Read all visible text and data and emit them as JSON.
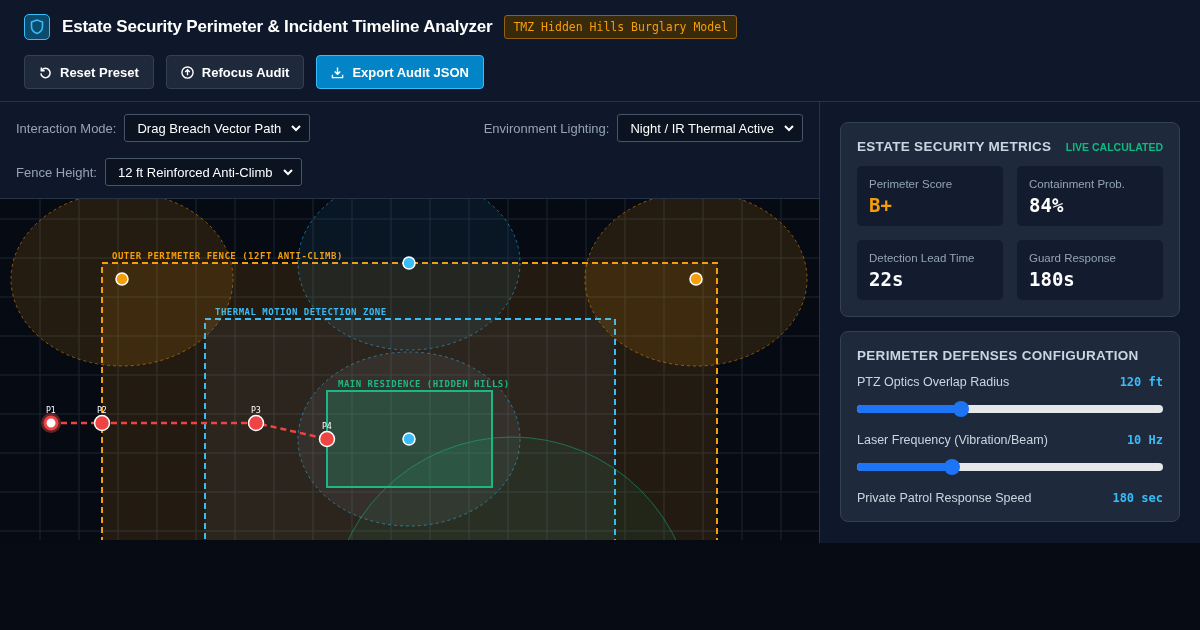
{
  "header": {
    "title": "Estate Security Perimeter & Incident Timeline Analyzer",
    "badge": "TMZ Hidden Hills Burglary Model"
  },
  "buttons": [
    {
      "label": "Reset Preset",
      "kind": "reset",
      "primary": false
    },
    {
      "label": "Refocus Audit",
      "kind": "refocus",
      "primary": false
    },
    {
      "label": "Export Audit JSON",
      "kind": "export",
      "primary": true
    }
  ],
  "controls": [
    {
      "label": "Interaction Mode:",
      "value": "Drag Breach Vector Path"
    },
    {
      "label": "Environment Lighting:",
      "value": "Night / IR Thermal Active"
    },
    {
      "label": "Fence Height:",
      "value": "12 ft Reinforced Anti-Climb"
    }
  ],
  "map": {
    "zones": [
      {
        "label": "OUTER PERIMETER FENCE (12FT ANTI-CLIMB)",
        "kind": "fence"
      },
      {
        "label": "THERMAL MOTION DETECTION ZONE",
        "kind": "thermal"
      },
      {
        "label": "MAIN RESIDENCE (HIDDEN HILLS)",
        "kind": "residence"
      }
    ],
    "path_points": [
      {
        "label": "P1",
        "selected": true
      },
      {
        "label": "P2",
        "selected": false
      },
      {
        "label": "P3",
        "selected": false
      },
      {
        "label": "P4",
        "selected": false
      }
    ]
  },
  "metrics": {
    "title": "ESTATE SECURITY METRICS",
    "status": "LIVE CALCULATED",
    "cards": [
      {
        "label": "Perimeter Score",
        "value": "B+",
        "color": "#f59e0b"
      },
      {
        "label": "Containment Prob.",
        "value": "84%",
        "color": "#ffffff"
      },
      {
        "label": "Detection Lead Time",
        "value": "22s",
        "color": "#ffffff"
      },
      {
        "label": "Guard Response",
        "value": "180s",
        "color": "#ffffff"
      }
    ]
  },
  "defenses": {
    "title": "PERIMETER DEFENSES CONFIGURATION",
    "sliders": [
      {
        "label": "PTZ Optics Overlap Radius",
        "reading": "120 ft",
        "level": 0.34
      },
      {
        "label": "Laser Frequency (Vibration/Beam)",
        "reading": "10 Hz",
        "level": 0.31
      },
      {
        "label": "Private Patrol Response Speed",
        "reading": "180 sec"
      }
    ]
  }
}
